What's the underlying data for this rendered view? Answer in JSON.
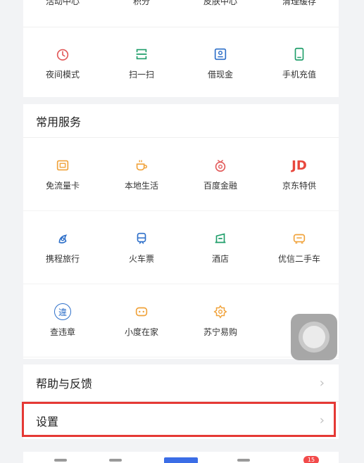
{
  "top_cut_labels": [
    "活动中心",
    "积分",
    "皮肤中心",
    "清理缓存"
  ],
  "top_items": [
    {
      "label": "夜间模式",
      "icon": "moon-icon",
      "color": "#e25b5b"
    },
    {
      "label": "扫一扫",
      "icon": "scan-icon",
      "color": "#1f9e6a"
    },
    {
      "label": "借现金",
      "icon": "cash-icon",
      "color": "#2d6fc9"
    },
    {
      "label": "手机充值",
      "icon": "phone-recharge-icon",
      "color": "#1f9e6a"
    }
  ],
  "services": {
    "title": "常用服务",
    "items": [
      {
        "label": "免流量卡",
        "icon": "sim-card-icon",
        "color": "#f0a23a"
      },
      {
        "label": "本地生活",
        "icon": "coffee-icon",
        "color": "#f0a23a"
      },
      {
        "label": "百度金融",
        "icon": "finance-icon",
        "color": "#e25b5b"
      },
      {
        "label": "京东特供",
        "icon": "jd-icon",
        "text": "JD",
        "color": "#e8473d"
      },
      {
        "label": "携程旅行",
        "icon": "ctrip-icon",
        "color": "#2d6fc9"
      },
      {
        "label": "火车票",
        "icon": "train-icon",
        "color": "#2d6fc9"
      },
      {
        "label": "酒店",
        "icon": "hotel-icon",
        "color": "#1f9e6a"
      },
      {
        "label": "优信二手车",
        "icon": "used-car-icon",
        "color": "#f0a23a"
      },
      {
        "label": "查违章",
        "icon": "violation-icon",
        "text": "違",
        "color": "#2d6fc9"
      },
      {
        "label": "小度在家",
        "icon": "xiaodu-icon",
        "color": "#f0a23a"
      },
      {
        "label": "苏宁易购",
        "icon": "suning-icon",
        "color": "#f0a23a"
      }
    ]
  },
  "help": {
    "label": "帮助与反馈"
  },
  "settings": {
    "label": "设置"
  },
  "chevron": "›",
  "highlight_color": "#e53935",
  "bottom_bar": {
    "badge": "15"
  }
}
